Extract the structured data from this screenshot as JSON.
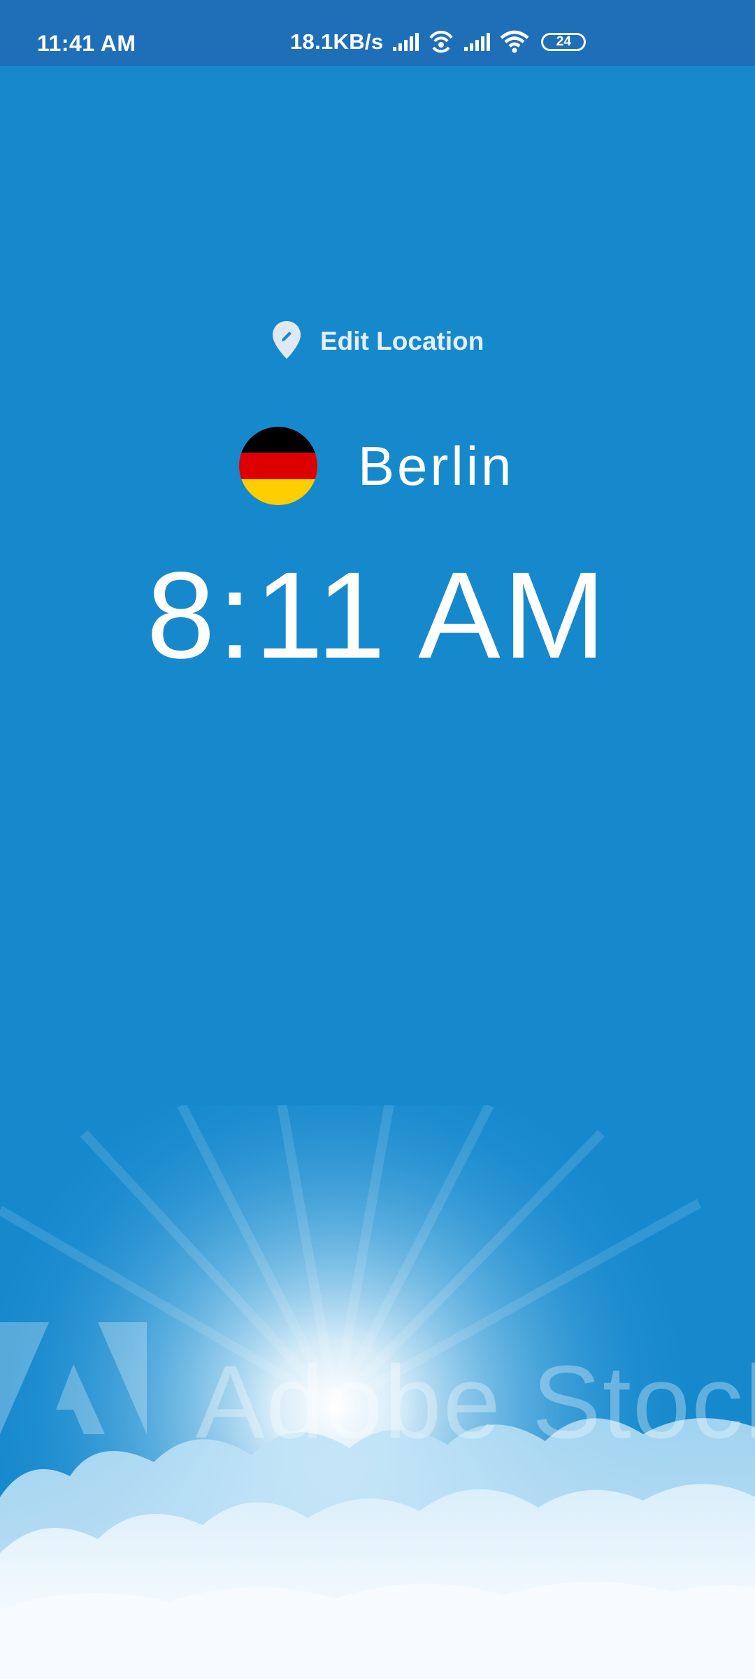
{
  "status_bar": {
    "time": "11:41 AM",
    "net_speed": "18.1KB/s",
    "battery": "24",
    "icons": [
      "signal-icon",
      "hotspot-icon",
      "signal-icon",
      "wifi-icon",
      "battery-icon"
    ]
  },
  "edit_location": {
    "label": "Edit Location",
    "icon": "location-pin-edit-icon"
  },
  "city": {
    "name": "Berlin",
    "flag_icon": "germany-flag-icon",
    "flag_colors": [
      "#000000",
      "#dd0000",
      "#ffce00"
    ]
  },
  "clock": {
    "time": "8:11 AM"
  },
  "background": {
    "watermark": "Adobe Stock",
    "sky_color": "#1689cd"
  }
}
